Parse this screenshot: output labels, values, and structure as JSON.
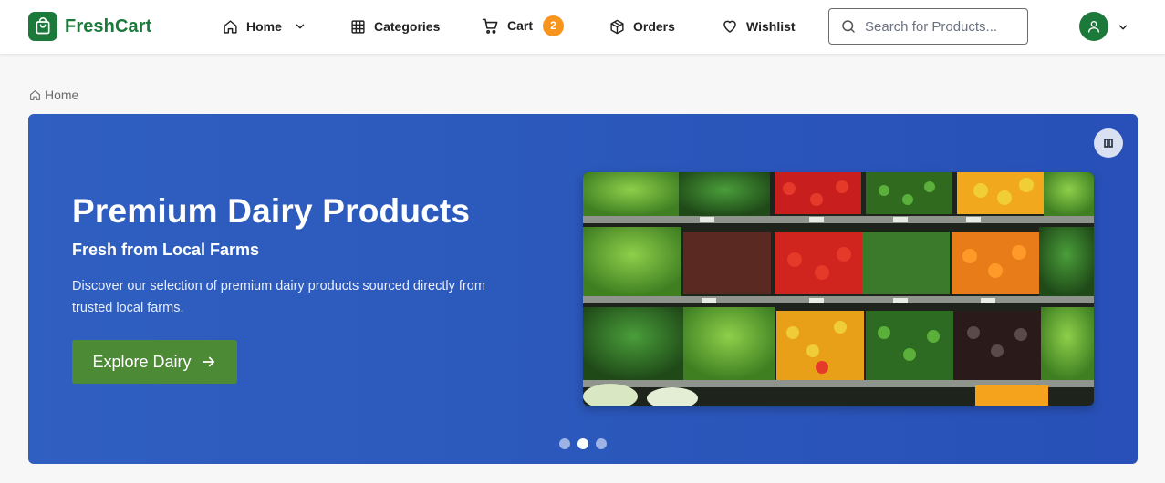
{
  "brand": {
    "name": "FreshCart",
    "color": "#1b7a3a"
  },
  "nav": {
    "home": "Home",
    "categories": "Categories",
    "cart": "Cart",
    "cart_count": "2",
    "orders": "Orders",
    "wishlist": "Wishlist"
  },
  "search": {
    "placeholder": "Search for Products...",
    "value": ""
  },
  "breadcrumb": {
    "home": "Home"
  },
  "hero": {
    "title": "Premium Dairy Products",
    "subtitle": "Fresh from Local Farms",
    "description": "Discover our selection of premium dairy products sourced directly from trusted local farms.",
    "cta": "Explore Dairy",
    "image_icon": "produce-shelf-photo",
    "slides_count": 3,
    "active_slide": 2,
    "background": "#2b57bb",
    "cta_color": "#4c8a36"
  },
  "colors": {
    "badge": "#f7941d",
    "accent": "#1b7a3a"
  }
}
